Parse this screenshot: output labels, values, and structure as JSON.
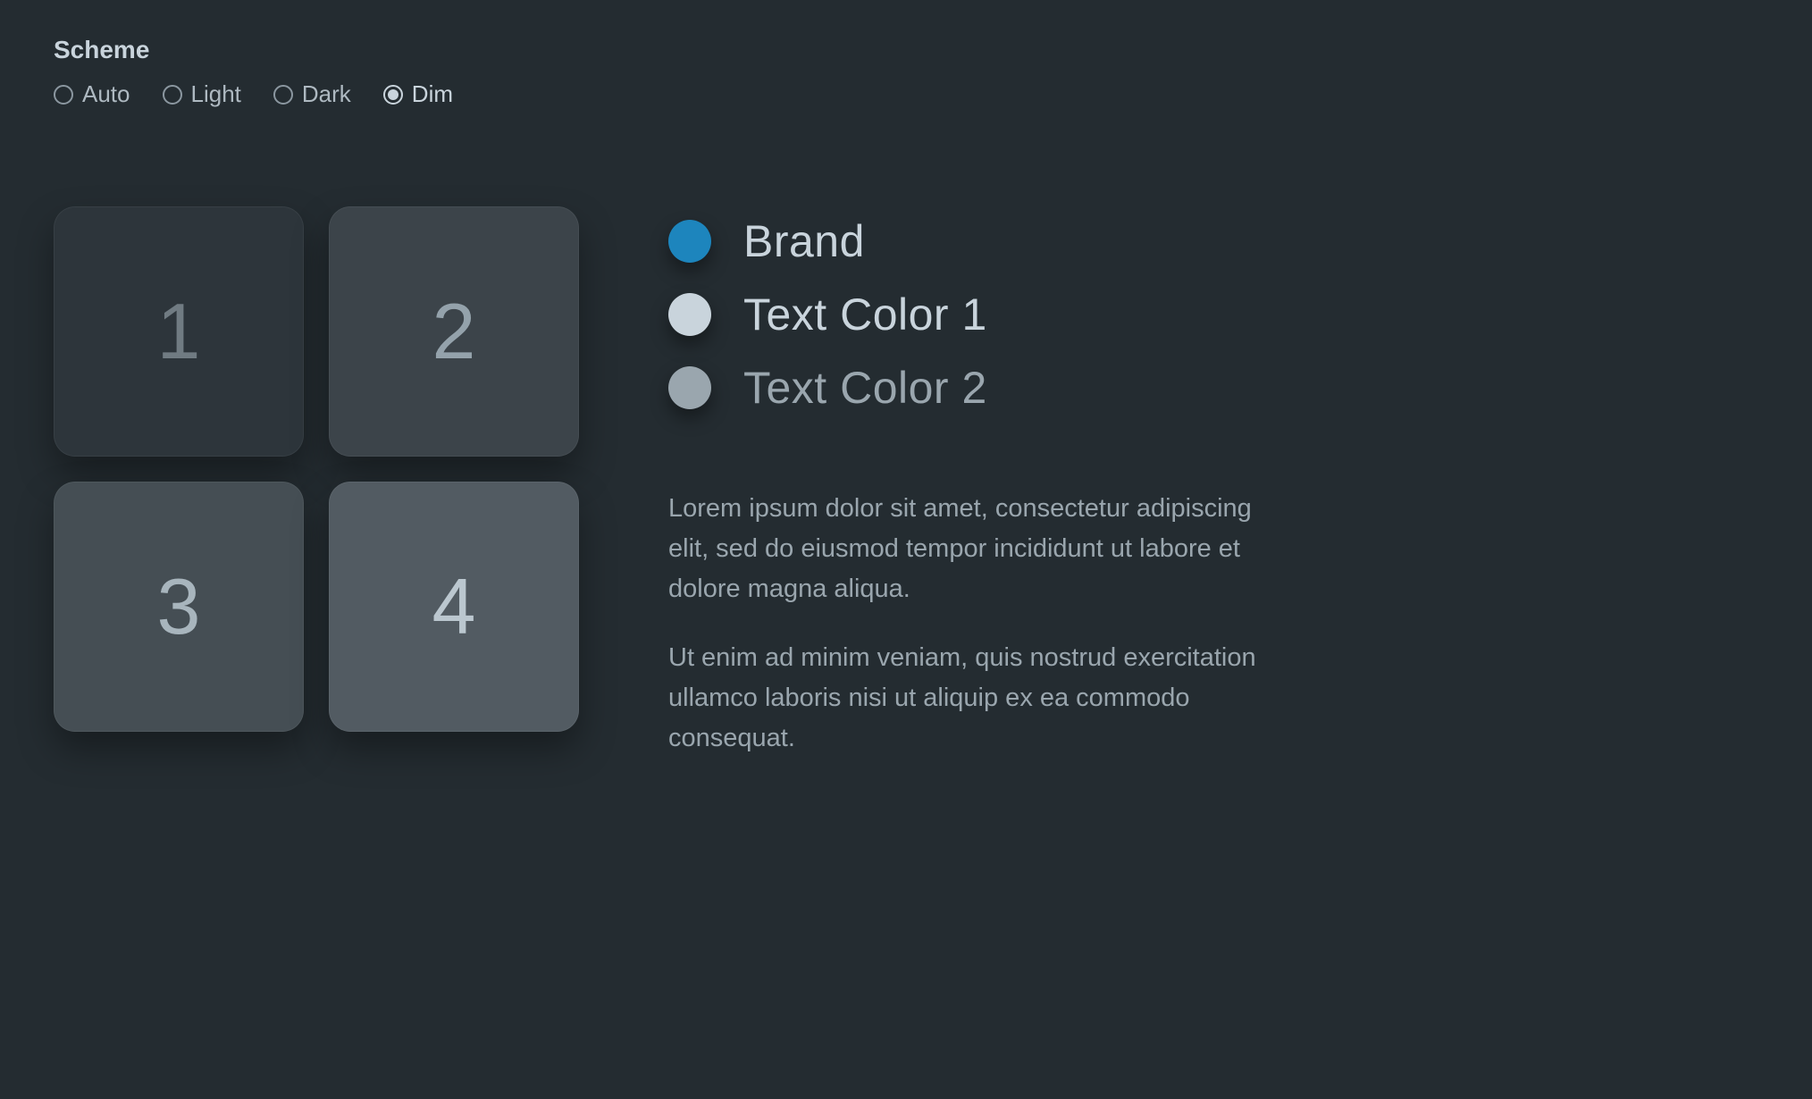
{
  "scheme": {
    "label": "Scheme",
    "options": [
      {
        "label": "Auto",
        "selected": false
      },
      {
        "label": "Light",
        "selected": false
      },
      {
        "label": "Dark",
        "selected": false
      },
      {
        "label": "Dim",
        "selected": true
      }
    ]
  },
  "tiles": [
    "1",
    "2",
    "3",
    "4"
  ],
  "swatches": [
    {
      "label": "Brand",
      "hex": "#1d85bd",
      "label_color": "#c9d4dc"
    },
    {
      "label": "Text Color 1",
      "hex": "#c9d4dc",
      "label_color": "#c9d4dc"
    },
    {
      "label": "Text Color 2",
      "hex": "#9aa6ae",
      "label_color": "#9aa6ae"
    }
  ],
  "paragraphs": [
    "Lorem ipsum dolor sit amet, consectetur adipiscing elit, sed do eiusmod tempor incididunt ut labore et dolore magna aliqua.",
    "Ut enim ad minim veniam, quis nostrud exercitation ullamco laboris nisi ut aliquip ex ea commodo consequat."
  ]
}
